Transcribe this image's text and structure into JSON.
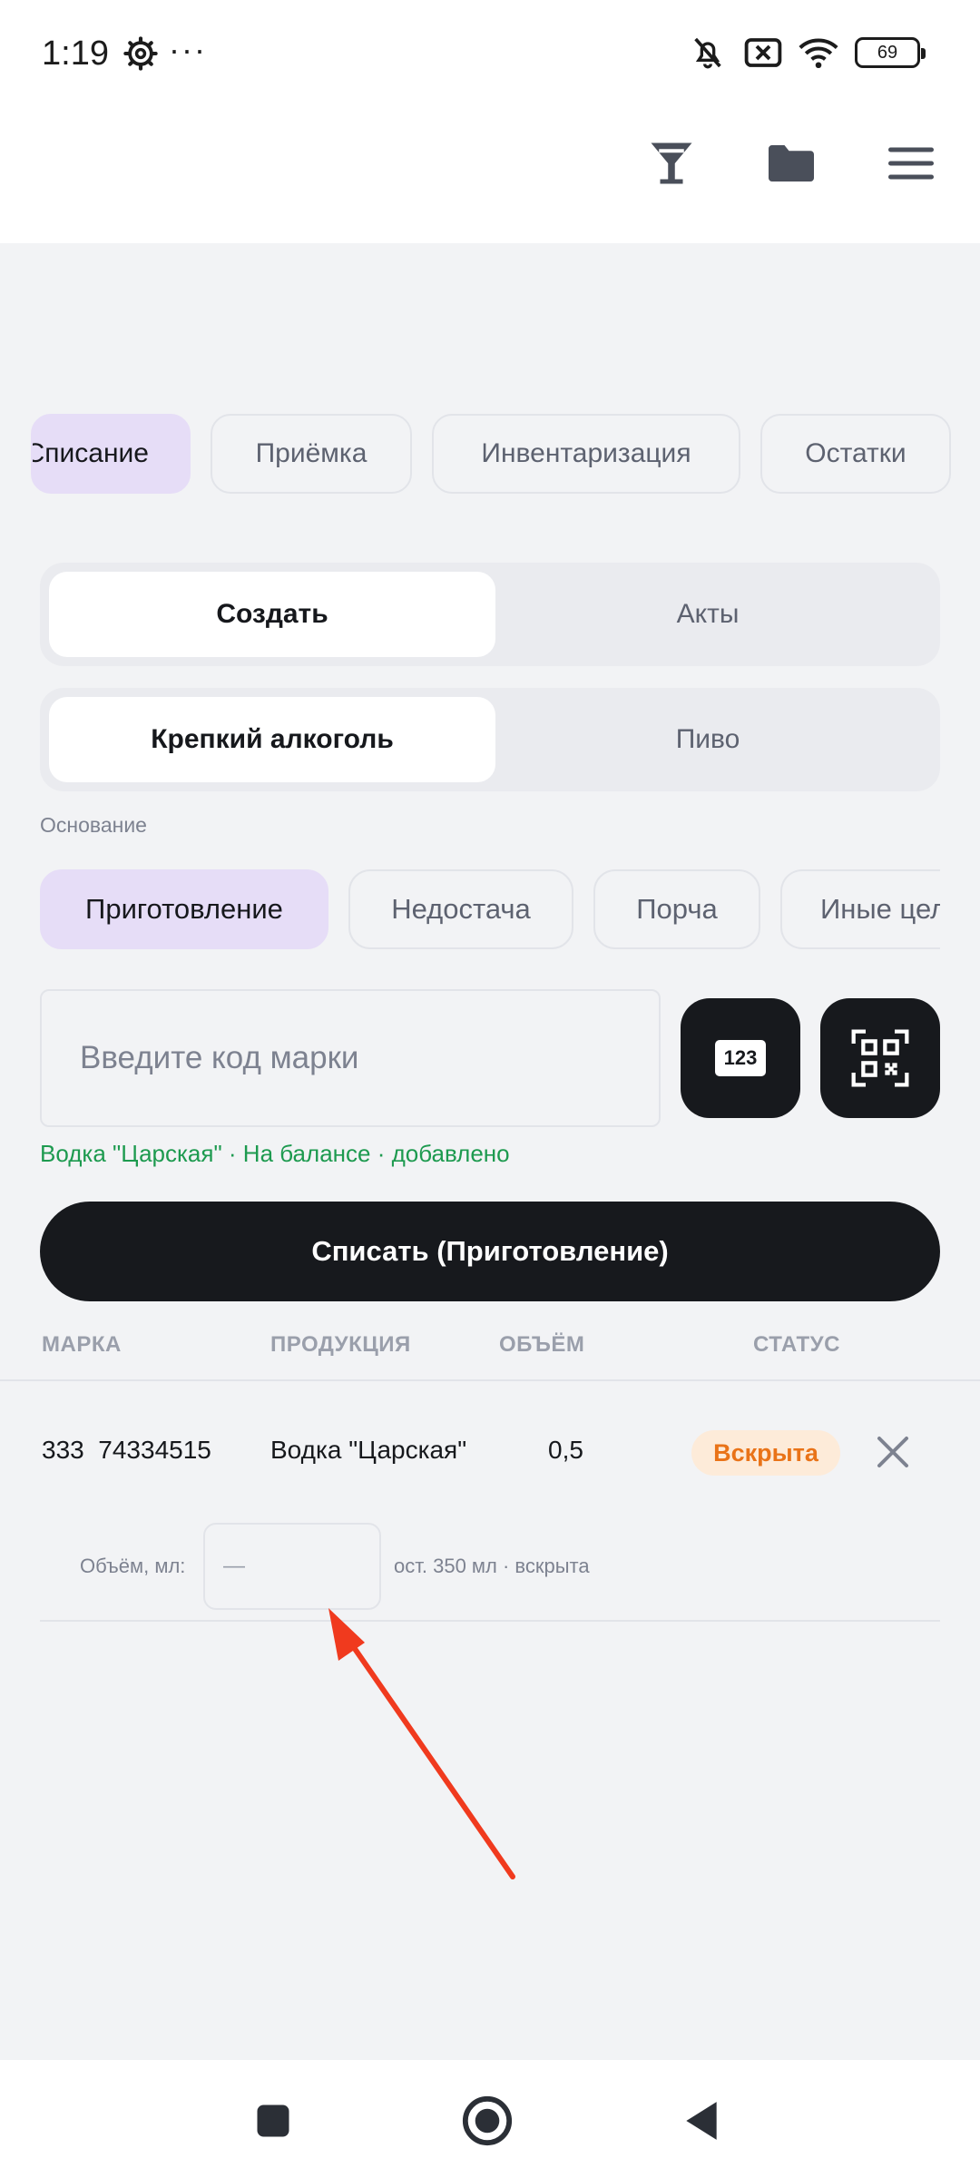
{
  "status_bar": {
    "time": "1:19",
    "dots": "···",
    "battery": "69",
    "icons": [
      "gear-icon",
      "muted-bell-icon",
      "no-sim-icon",
      "wifi-icon",
      "battery-icon"
    ]
  },
  "header": {
    "icons": [
      "cocktail-glass-icon",
      "folder-icon",
      "menu-icon"
    ]
  },
  "module_tabs": [
    {
      "label": "Списание",
      "active": true
    },
    {
      "label": "Приёмка",
      "active": false
    },
    {
      "label": "Инвентаризация",
      "active": false
    },
    {
      "label": "Остатки",
      "active": false
    }
  ],
  "mode_toggle": {
    "create": "Создать",
    "acts": "Акты",
    "selected": "Создать"
  },
  "category_toggle": {
    "strong": "Крепкий алкоголь",
    "beer": "Пиво",
    "selected": "Крепкий алкоголь"
  },
  "reason": {
    "label": "Основание",
    "options": [
      "Приготовление",
      "Недостача",
      "Порча",
      "Иные цел"
    ],
    "selected": "Приготовление"
  },
  "code_input": {
    "placeholder": "Введите код марки",
    "value": ""
  },
  "keypad_button": {
    "label": "123"
  },
  "scan_status": "Водка \"Царская\" · На балансе · добавлено",
  "write_off_button": "Списать (Приготовление)",
  "table": {
    "headers": [
      "МАРКА",
      "ПРОДУКЦИЯ",
      "ОБЪЁМ",
      "СТАТУС"
    ],
    "rows": [
      {
        "mark": "333  74334515",
        "product": "Водка \"Царская\"",
        "volume": "0,5",
        "status": "Вскрыта",
        "volume_label": "Объём, мл:",
        "volume_placeholder": "—",
        "note": "ост. 350 мл · вскрыта"
      }
    ]
  },
  "colors": {
    "accent_tab": "#e6ddf7",
    "dark_button": "#17191d",
    "success_text": "#1d9a4f",
    "badge_bg": "#fdebd9",
    "badge_text": "#e97318",
    "annotation_arrow": "#f03a1e"
  },
  "nav_bar": {
    "icons": [
      "recents-square-icon",
      "home-circle-icon",
      "back-triangle-icon"
    ]
  }
}
